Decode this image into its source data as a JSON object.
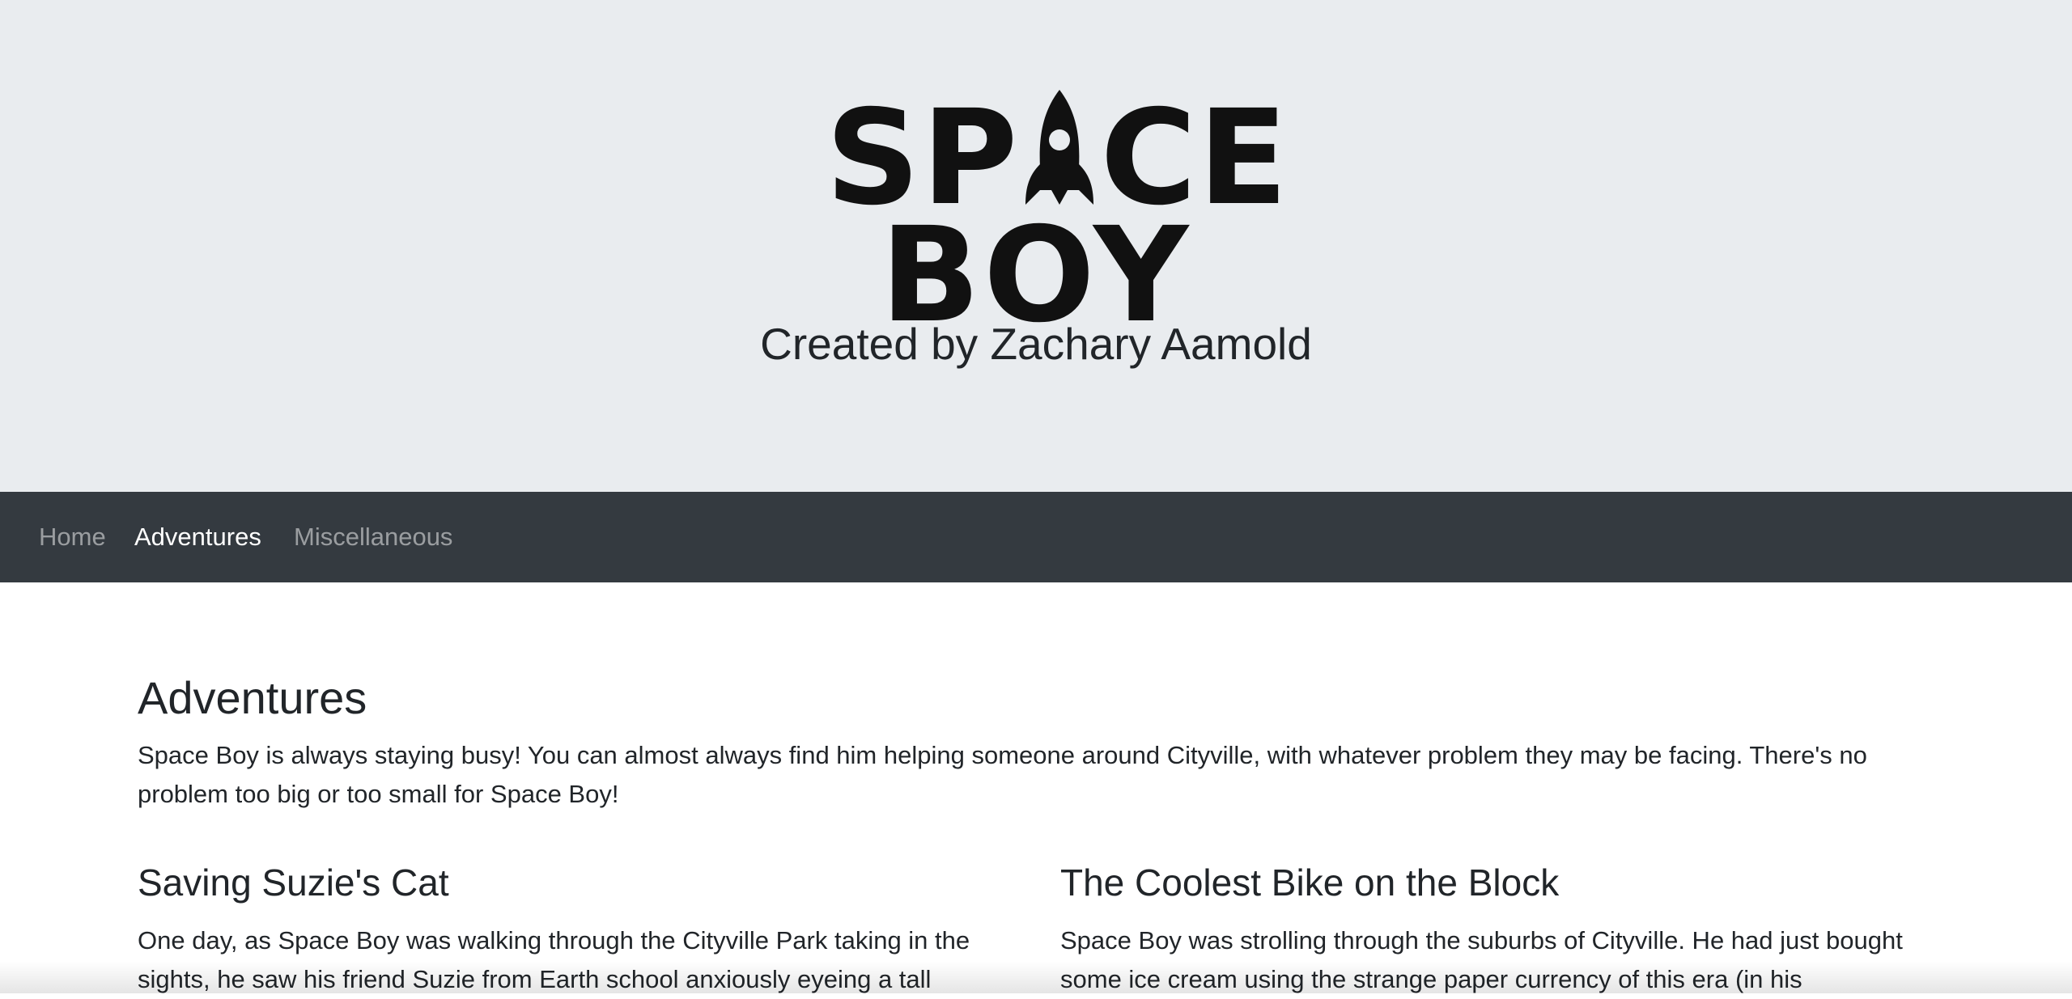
{
  "header": {
    "logo": {
      "line1_left": "SP",
      "line1_right": "CE",
      "line2": "BOY",
      "rocket_icon": "rocket-icon"
    },
    "tagline": "Created by Zachary Aamold",
    "background_color": "#e9ecef"
  },
  "navbar": {
    "background_color": "#343a40",
    "items": [
      {
        "label": "Home",
        "active": false
      },
      {
        "label": "Adventures",
        "active": true
      },
      {
        "label": "Miscellaneous",
        "active": false
      }
    ]
  },
  "main": {
    "title": "Adventures",
    "intro": "Space Boy is always staying busy! You can almost always find him helping someone around Cityville, with whatever problem they may be facing. There's no problem too big or too small for Space Boy!",
    "stories": [
      {
        "title": "Saving Suzie's Cat",
        "excerpt": "One day, as Space Boy was walking through the Cityville Park taking in the sights, he saw his friend Suzie from Earth school anxiously eyeing a tall"
      },
      {
        "title": "The Coolest Bike on the Block",
        "excerpt": "Space Boy was strolling through the suburbs of Cityville. He had just bought some ice cream using the strange paper currency of this era (in his"
      }
    ]
  }
}
